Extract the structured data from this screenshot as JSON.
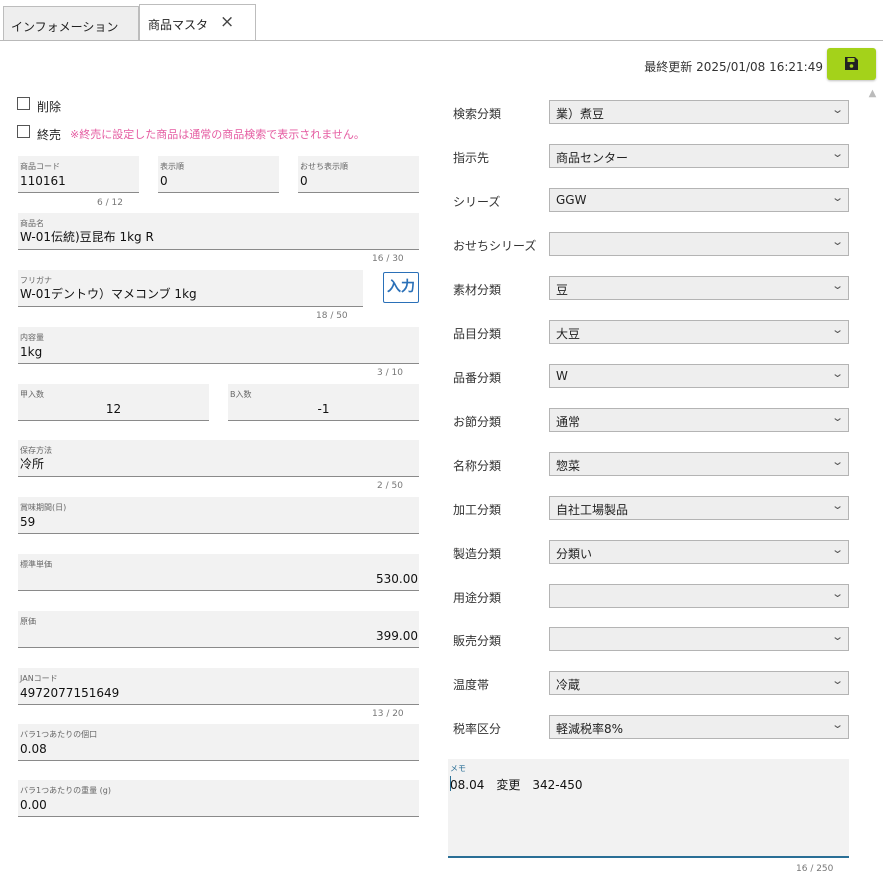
{
  "tabs": [
    {
      "label": "インフォメーション"
    },
    {
      "label": "商品マスタ",
      "close": "×"
    }
  ],
  "header": {
    "updated_label": "最終更新",
    "updated_value": "2025/01/08 16:21:49",
    "save_icon": "floppy-disk"
  },
  "flags": {
    "delete_label": "削除",
    "discontinued_label": "終売",
    "notice": "※終売に設定した商品は通常の商品検索で表示されません。",
    "delete_checked": false,
    "discontinued_checked": false
  },
  "fields": {
    "product_code": {
      "label": "商品コード",
      "value": "110161",
      "count": "6 / 12"
    },
    "display_order": {
      "label": "表示順",
      "value": "0"
    },
    "osechi_order": {
      "label": "おせち表示順",
      "value": "0"
    },
    "product_name": {
      "label": "商品名",
      "value": "W-01伝統)豆昆布 1kg R",
      "count": "16 / 30"
    },
    "furigana": {
      "label": "フリガナ",
      "value": "W-01デントウ）マメコンブ 1kg",
      "count": "18 / 50",
      "button": "入力"
    },
    "content": {
      "label": "内容量",
      "value": "1kg",
      "count": "3 / 10"
    },
    "a_qty": {
      "label": "甲入数",
      "value": "12"
    },
    "b_qty": {
      "label": "B入数",
      "value": "-1"
    },
    "storage": {
      "label": "保存方法",
      "value": "冷所",
      "count": "2 / 50"
    },
    "shelf_life": {
      "label": "賞味期間(日)",
      "value": "59"
    },
    "std_price": {
      "label": "標準単価",
      "value": "530.00"
    },
    "cost": {
      "label": "原価",
      "value": "399.00"
    },
    "jan": {
      "label": "JANコード",
      "value": "4972077151649",
      "count": "13 / 20"
    },
    "piece_price": {
      "label": "バラ1つあたりの個口",
      "value": "0.08"
    },
    "piece_weight": {
      "label": "バラ1つあたりの重量 (g)",
      "value": "0.00"
    }
  },
  "classifications": [
    {
      "label": "検索分類",
      "value": "業）煮豆"
    },
    {
      "label": "指示先",
      "value": "商品センター"
    },
    {
      "label": "シリーズ",
      "value": "GGW"
    },
    {
      "label": "おせちシリーズ",
      "value": ""
    },
    {
      "label": "素材分類",
      "value": "豆"
    },
    {
      "label": "品目分類",
      "value": "大豆"
    },
    {
      "label": "品番分類",
      "value": "W"
    },
    {
      "label": "お節分類",
      "value": "通常"
    },
    {
      "label": "名称分類",
      "value": "惣菜"
    },
    {
      "label": "加工分類",
      "value": "自社工場製品"
    },
    {
      "label": "製造分類",
      "value": "分類い"
    },
    {
      "label": "用途分類",
      "value": ""
    },
    {
      "label": "販売分類",
      "value": ""
    },
    {
      "label": "温度帯",
      "value": "冷蔵"
    },
    {
      "label": "税率区分",
      "value": "軽減税率8%"
    }
  ],
  "memo": {
    "label": "メモ",
    "value": "08.04　変更　342-450",
    "count": "16 / 250"
  }
}
